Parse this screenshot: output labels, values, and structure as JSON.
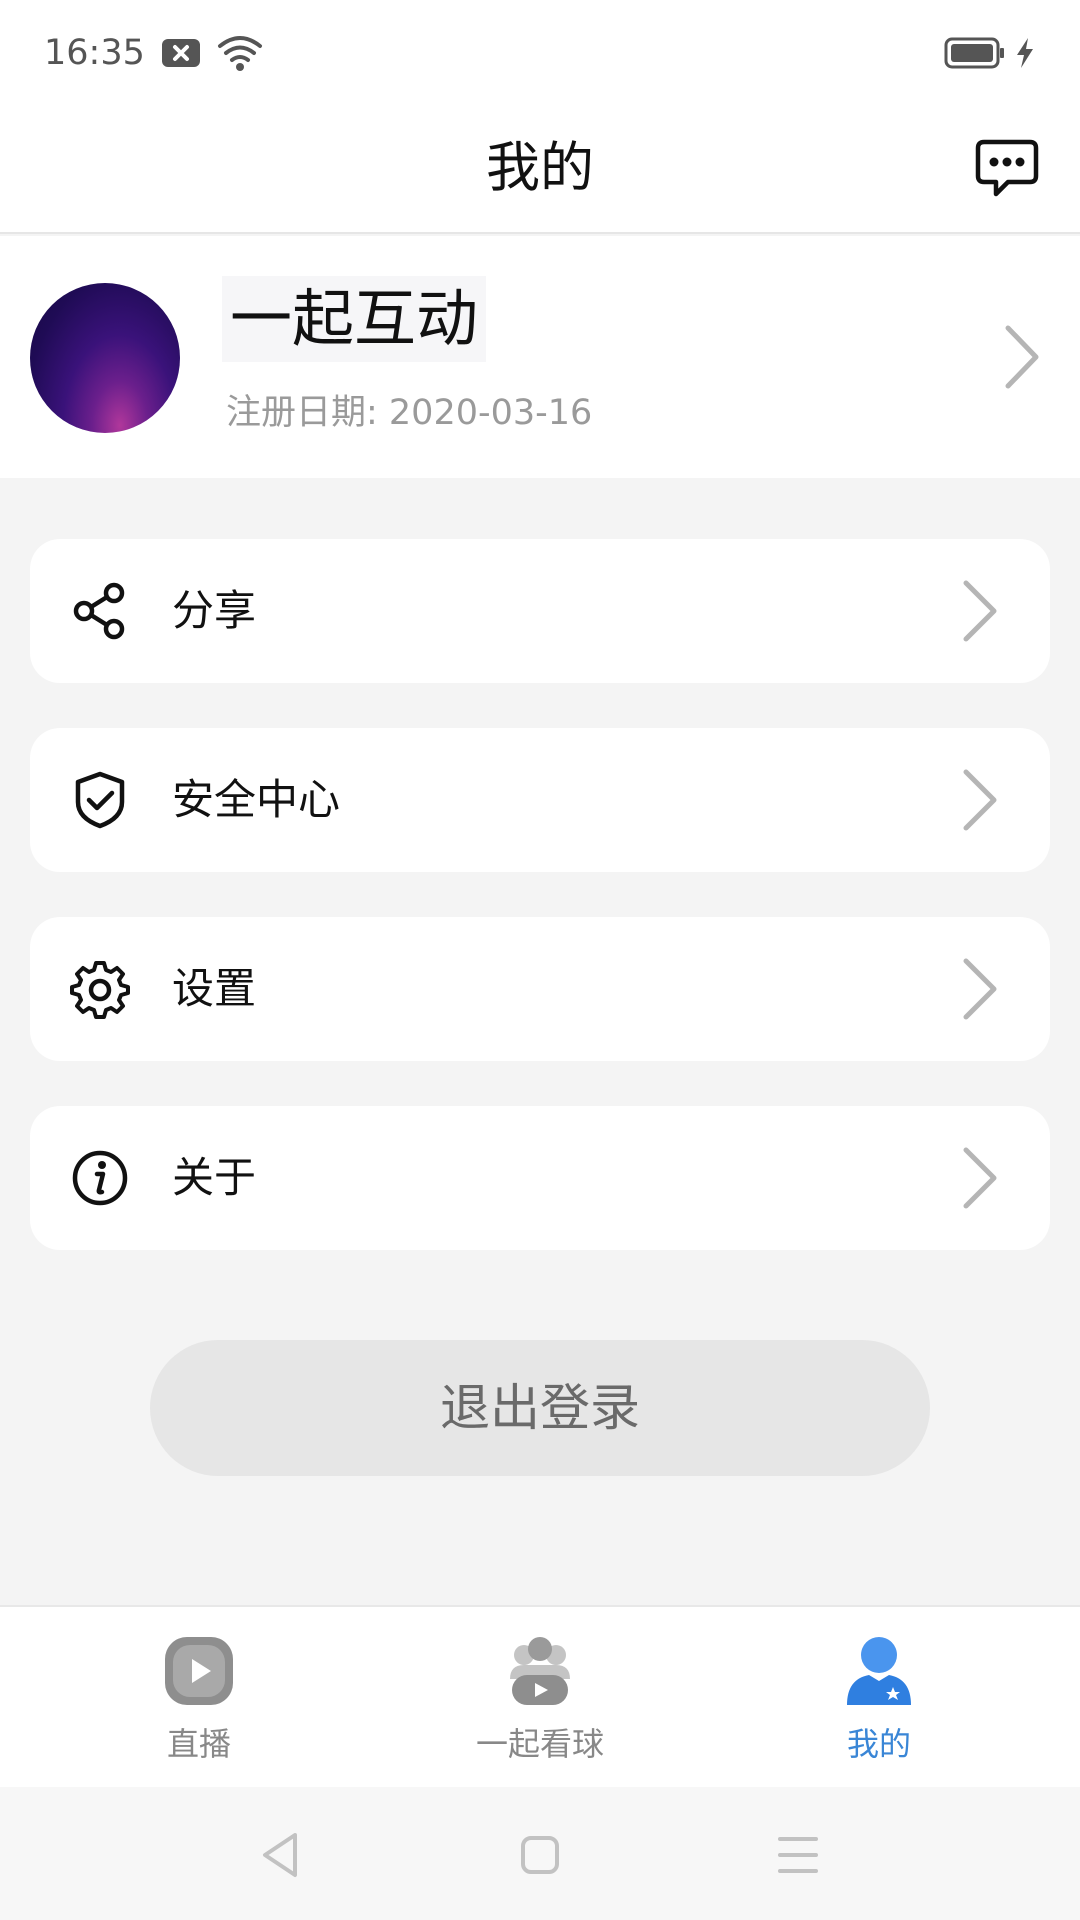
{
  "status_bar": {
    "time": "16:35",
    "icons": [
      "notification-icon",
      "wifi-icon",
      "battery-icon",
      "charging-icon"
    ]
  },
  "header": {
    "title": "我的",
    "message_icon": "message-icon"
  },
  "profile": {
    "name": "一起互动",
    "register_date": "注册日期: 2020-03-16"
  },
  "menu": [
    {
      "label": "分享",
      "icon": "share-icon"
    },
    {
      "label": "安全中心",
      "icon": "shield-icon"
    },
    {
      "label": "设置",
      "icon": "gear-icon"
    },
    {
      "label": "关于",
      "icon": "info-icon"
    }
  ],
  "logout_label": "退出登录",
  "bottom_nav": [
    {
      "label": "直播",
      "icon": "play-icon",
      "active": false
    },
    {
      "label": "一起看球",
      "icon": "group-watch-icon",
      "active": false
    },
    {
      "label": "我的",
      "icon": "user-icon",
      "active": true
    }
  ],
  "colors": {
    "accent": "#3a86d6",
    "background": "#f4f4f4",
    "card": "#ffffff",
    "logout_bg": "#e6e6e6"
  }
}
